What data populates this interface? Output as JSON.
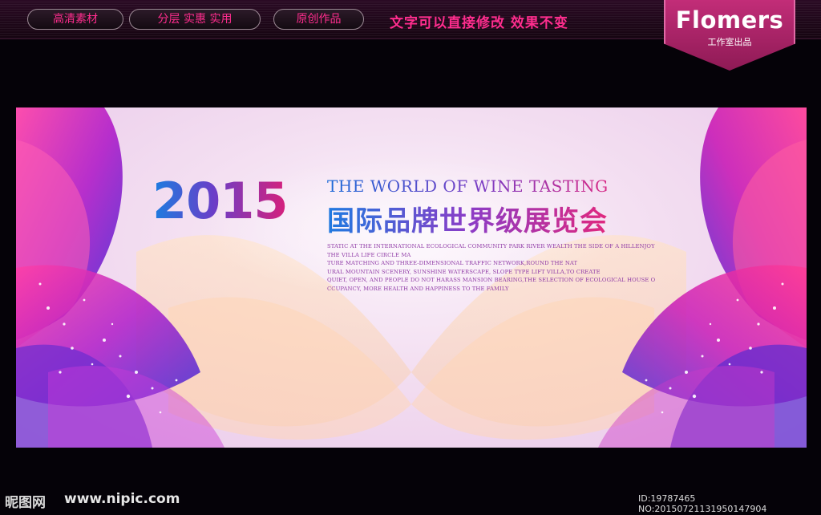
{
  "header": {
    "tabs": [
      {
        "label": "高清素材"
      },
      {
        "label": "分层 实惠 实用"
      },
      {
        "label": "原创作品"
      }
    ],
    "slogan": "文字可以直接修改  效果不变",
    "badge": {
      "title": "Flomers",
      "subtitle": "工作室出品"
    }
  },
  "banner": {
    "year": "2015",
    "title_en": "THE WORLD OF WINE TASTING",
    "title_cn": "国际品牌世界级展览会",
    "body_lines": [
      "STATIC AT THE INTERNATIONAL ECOLOGICAL COMMUNITY PARK RIVER WEALTH THE SIDE OF A HILLENJOY",
      "THE VILLA LIFE CIRCLE MA",
      "TURE MATCHING AND THREE-DIMENSIONAL TRAFFIC NETWORK,ROUND THE NAT",
      "URAL MOUNTAIN SCENERY, SUNSHINE WATERSCAPE, SLOPE TYPE LIFT VILLA,TO CREATE",
      "QUIET, OPEN, AND PEOPLE DO NOT HARASS MANSION BEARING,THE SELECTION OF ECOLOGICAL HOUSE O",
      "CCUPANCY, MORE HEALTH AND HAPPINESS TO THE FAMILY"
    ],
    "colors": {
      "blue": "#1f7ae0",
      "purple": "#8a3cc7",
      "magenta": "#e0287e"
    }
  },
  "footer": {
    "logo": "昵图网",
    "site": "www.nipic.com",
    "id_text": "ID:19787465 NO:20150721131950147904"
  }
}
